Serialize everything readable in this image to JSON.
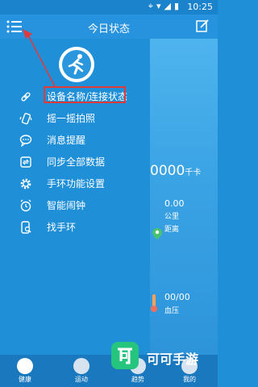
{
  "status_bar": {
    "time": "10:25",
    "icons": [
      "location-icon",
      "wifi-icon",
      "signal-icon",
      "battery-icon"
    ]
  },
  "header": {
    "title": "今日状态",
    "menu_icon": "menu-icon",
    "edit_icon": "edit-icon"
  },
  "drawer": {
    "logo_icon": "running-person-icon",
    "items": [
      {
        "label": "设备名称/连接状态",
        "icon": "link-icon",
        "highlighted": true
      },
      {
        "label": "摇一摇拍照",
        "icon": "shake-phone-icon"
      },
      {
        "label": "消息提醒",
        "icon": "message-icon"
      },
      {
        "label": "同步全部数据",
        "icon": "sync-icon"
      },
      {
        "label": "手环功能设置",
        "icon": "gear-icon"
      },
      {
        "label": "智能闹钟",
        "icon": "alarm-clock-icon"
      },
      {
        "label": "找手环",
        "icon": "find-band-icon"
      }
    ]
  },
  "main": {
    "calories_value": "0000",
    "calories_unit": "千卡",
    "distance_value": "0.00",
    "distance_unit": "公里",
    "distance_label": "距离",
    "pressure_value": "00/00",
    "pressure_label": "血压"
  },
  "tabbar": {
    "tabs": [
      {
        "label": "健康",
        "active": true
      },
      {
        "label": "运动"
      },
      {
        "label": "趋势"
      },
      {
        "label": "我的"
      }
    ]
  },
  "watermark": {
    "text": "可可手游"
  },
  "colors": {
    "primary": "#1f8fd8",
    "header": "#2792de",
    "tabbar": "#1a78bf",
    "highlight": "#e23a3a",
    "watermark": "#25c57e"
  }
}
